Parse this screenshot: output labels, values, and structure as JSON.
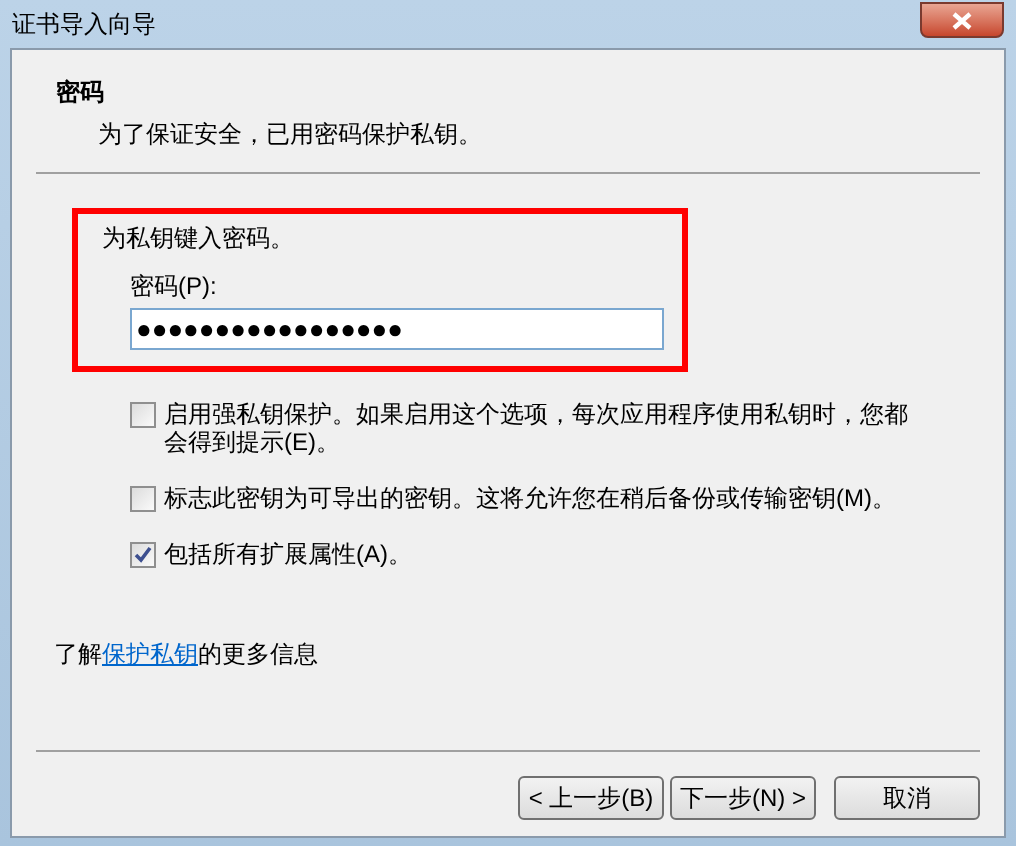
{
  "window": {
    "title": "证书导入向导"
  },
  "header": {
    "title": "密码",
    "subtitle": "为了保证安全，已用密码保护私钥。"
  },
  "password_section": {
    "instruction": "为私钥键入密码。",
    "label": "密码(P):",
    "value": "●●●●●●●●●●●●●●●●●"
  },
  "options": [
    {
      "label": "启用强私钥保护。如果启用这个选项，每次应用程序使用私钥时，您都会得到提示(E)。",
      "checked": false
    },
    {
      "label": "标志此密钥为可导出的密钥。这将允许您在稍后备份或传输密钥(M)。",
      "checked": false
    },
    {
      "label": "包括所有扩展属性(A)。",
      "checked": true
    }
  ],
  "info": {
    "before": "了解",
    "link": "保护私钥",
    "after": "的更多信息"
  },
  "buttons": [
    "< 上一步(B)",
    "下一步(N) >",
    "取消"
  ]
}
